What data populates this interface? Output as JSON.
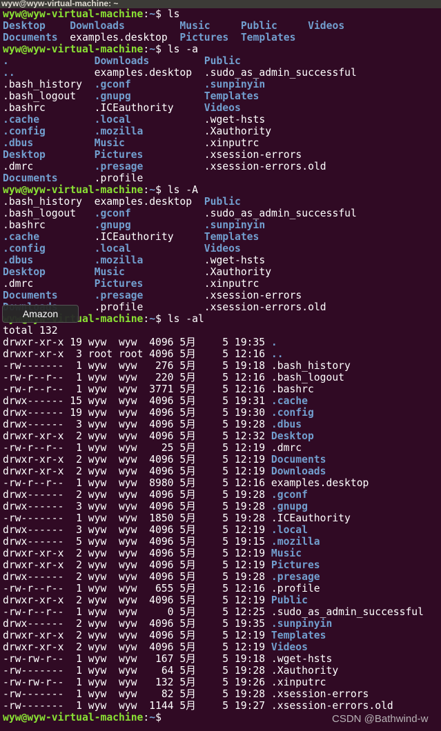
{
  "window": {
    "title": "wyw@wyw-virtual-machine: ~"
  },
  "prompt": {
    "user_host": "wyw@wyw-virtual-machine",
    "sep": ":",
    "path": "~",
    "symbol": "$ "
  },
  "colors": {
    "background": "#300a24",
    "prompt": "#8ae234",
    "directory": "#729fcf",
    "text": "#ffffff"
  },
  "listings": [
    {
      "command": "ls",
      "columns": [
        [
          {
            "name": "Desktop",
            "dir": true
          },
          {
            "name": "Documents",
            "dir": true
          }
        ],
        [
          {
            "name": "Downloads",
            "dir": true
          },
          {
            "name": "examples.desktop",
            "dir": false
          }
        ],
        [
          {
            "name": "Music",
            "dir": true
          },
          {
            "name": "Pictures",
            "dir": true
          }
        ],
        [
          {
            "name": "Public",
            "dir": true
          },
          {
            "name": "Templates",
            "dir": true
          }
        ],
        [
          {
            "name": "Videos",
            "dir": true
          }
        ]
      ]
    },
    {
      "command": "ls -a",
      "columns": [
        [
          {
            "name": ".",
            "dir": true
          },
          {
            "name": "..",
            "dir": true
          },
          {
            "name": ".bash_history",
            "dir": false
          },
          {
            "name": ".bash_logout",
            "dir": false
          },
          {
            "name": ".bashrc",
            "dir": false
          },
          {
            "name": ".cache",
            "dir": true
          },
          {
            "name": ".config",
            "dir": true
          },
          {
            "name": ".dbus",
            "dir": true
          },
          {
            "name": "Desktop",
            "dir": true
          },
          {
            "name": ".dmrc",
            "dir": false
          },
          {
            "name": "Documents",
            "dir": true
          }
        ],
        [
          {
            "name": "Downloads",
            "dir": true
          },
          {
            "name": "examples.desktop",
            "dir": false
          },
          {
            "name": ".gconf",
            "dir": true
          },
          {
            "name": ".gnupg",
            "dir": true
          },
          {
            "name": ".ICEauthority",
            "dir": false
          },
          {
            "name": ".local",
            "dir": true
          },
          {
            "name": ".mozilla",
            "dir": true
          },
          {
            "name": "Music",
            "dir": true
          },
          {
            "name": "Pictures",
            "dir": true
          },
          {
            "name": ".presage",
            "dir": true
          },
          {
            "name": ".profile",
            "dir": false
          }
        ],
        [
          {
            "name": "Public",
            "dir": true
          },
          {
            "name": ".sudo_as_admin_successful",
            "dir": false
          },
          {
            "name": ".sunpinyin",
            "dir": true
          },
          {
            "name": "Templates",
            "dir": true
          },
          {
            "name": "Videos",
            "dir": true
          },
          {
            "name": ".wget-hsts",
            "dir": false
          },
          {
            "name": ".Xauthority",
            "dir": false
          },
          {
            "name": ".xinputrc",
            "dir": false
          },
          {
            "name": ".xsession-errors",
            "dir": false
          },
          {
            "name": ".xsession-errors.old",
            "dir": false
          }
        ]
      ]
    },
    {
      "command": "ls -A",
      "columns": [
        [
          {
            "name": ".bash_history",
            "dir": false
          },
          {
            "name": ".bash_logout",
            "dir": false
          },
          {
            "name": ".bashrc",
            "dir": false
          },
          {
            "name": ".cache",
            "dir": true
          },
          {
            "name": ".config",
            "dir": true
          },
          {
            "name": ".dbus",
            "dir": true
          },
          {
            "name": "Desktop",
            "dir": true
          },
          {
            "name": ".dmrc",
            "dir": false
          },
          {
            "name": "Documents",
            "dir": true
          },
          {
            "name": "Downloads",
            "dir": true
          }
        ],
        [
          {
            "name": "examples.desktop",
            "dir": false
          },
          {
            "name": ".gconf",
            "dir": true
          },
          {
            "name": ".gnupg",
            "dir": true
          },
          {
            "name": ".ICEauthority",
            "dir": false
          },
          {
            "name": ".local",
            "dir": true
          },
          {
            "name": ".mozilla",
            "dir": true
          },
          {
            "name": "Music",
            "dir": true
          },
          {
            "name": "Pictures",
            "dir": true
          },
          {
            "name": ".presage",
            "dir": true
          },
          {
            "name": ".profile",
            "dir": false
          }
        ],
        [
          {
            "name": "Public",
            "dir": true
          },
          {
            "name": ".sudo_as_admin_successful",
            "dir": false
          },
          {
            "name": ".sunpinyin",
            "dir": true
          },
          {
            "name": "Templates",
            "dir": true
          },
          {
            "name": "Videos",
            "dir": true
          },
          {
            "name": ".wget-hsts",
            "dir": false
          },
          {
            "name": ".Xauthority",
            "dir": false
          },
          {
            "name": ".xinputrc",
            "dir": false
          },
          {
            "name": ".xsession-errors",
            "dir": false
          },
          {
            "name": ".xsession-errors.old",
            "dir": false
          }
        ]
      ]
    }
  ],
  "long_listing": {
    "command": "ls -al",
    "total": "total 132",
    "rows": [
      {
        "mode": "drwxr-xr-x",
        "links": "19",
        "owner": "wyw",
        "group": "wyw",
        "size": "4096",
        "month": "5月",
        "day": "5",
        "time": "19:35",
        "name": ".",
        "dir": true
      },
      {
        "mode": "drwxr-xr-x",
        "links": "3",
        "owner": "root",
        "group": "root",
        "size": "4096",
        "month": "5月",
        "day": "5",
        "time": "12:16",
        "name": "..",
        "dir": true
      },
      {
        "mode": "-rw-------",
        "links": "1",
        "owner": "wyw",
        "group": "wyw",
        "size": "276",
        "month": "5月",
        "day": "5",
        "time": "19:18",
        "name": ".bash_history",
        "dir": false
      },
      {
        "mode": "-rw-r--r--",
        "links": "1",
        "owner": "wyw",
        "group": "wyw",
        "size": "220",
        "month": "5月",
        "day": "5",
        "time": "12:16",
        "name": ".bash_logout",
        "dir": false
      },
      {
        "mode": "-rw-r--r--",
        "links": "1",
        "owner": "wyw",
        "group": "wyw",
        "size": "3771",
        "month": "5月",
        "day": "5",
        "time": "12:16",
        "name": ".bashrc",
        "dir": false
      },
      {
        "mode": "drwx------",
        "links": "15",
        "owner": "wyw",
        "group": "wyw",
        "size": "4096",
        "month": "5月",
        "day": "5",
        "time": "19:31",
        "name": ".cache",
        "dir": true
      },
      {
        "mode": "drwx------",
        "links": "19",
        "owner": "wyw",
        "group": "wyw",
        "size": "4096",
        "month": "5月",
        "day": "5",
        "time": "19:30",
        "name": ".config",
        "dir": true
      },
      {
        "mode": "drwx------",
        "links": "3",
        "owner": "wyw",
        "group": "wyw",
        "size": "4096",
        "month": "5月",
        "day": "5",
        "time": "19:28",
        "name": ".dbus",
        "dir": true
      },
      {
        "mode": "drwxr-xr-x",
        "links": "2",
        "owner": "wyw",
        "group": "wyw",
        "size": "4096",
        "month": "5月",
        "day": "5",
        "time": "12:32",
        "name": "Desktop",
        "dir": true
      },
      {
        "mode": "-rw-r--r--",
        "links": "1",
        "owner": "wyw",
        "group": "wyw",
        "size": "25",
        "month": "5月",
        "day": "5",
        "time": "12:19",
        "name": ".dmrc",
        "dir": false
      },
      {
        "mode": "drwxr-xr-x",
        "links": "2",
        "owner": "wyw",
        "group": "wyw",
        "size": "4096",
        "month": "5月",
        "day": "5",
        "time": "12:19",
        "name": "Documents",
        "dir": true
      },
      {
        "mode": "drwxr-xr-x",
        "links": "2",
        "owner": "wyw",
        "group": "wyw",
        "size": "4096",
        "month": "5月",
        "day": "5",
        "time": "12:19",
        "name": "Downloads",
        "dir": true
      },
      {
        "mode": "-rw-r--r--",
        "links": "1",
        "owner": "wyw",
        "group": "wyw",
        "size": "8980",
        "month": "5月",
        "day": "5",
        "time": "12:16",
        "name": "examples.desktop",
        "dir": false
      },
      {
        "mode": "drwx------",
        "links": "2",
        "owner": "wyw",
        "group": "wyw",
        "size": "4096",
        "month": "5月",
        "day": "5",
        "time": "19:28",
        "name": ".gconf",
        "dir": true
      },
      {
        "mode": "drwx------",
        "links": "3",
        "owner": "wyw",
        "group": "wyw",
        "size": "4096",
        "month": "5月",
        "day": "5",
        "time": "19:28",
        "name": ".gnupg",
        "dir": true
      },
      {
        "mode": "-rw-------",
        "links": "1",
        "owner": "wyw",
        "group": "wyw",
        "size": "1850",
        "month": "5月",
        "day": "5",
        "time": "19:28",
        "name": ".ICEauthority",
        "dir": false
      },
      {
        "mode": "drwx------",
        "links": "3",
        "owner": "wyw",
        "group": "wyw",
        "size": "4096",
        "month": "5月",
        "day": "5",
        "time": "12:19",
        "name": ".local",
        "dir": true
      },
      {
        "mode": "drwx------",
        "links": "5",
        "owner": "wyw",
        "group": "wyw",
        "size": "4096",
        "month": "5月",
        "day": "5",
        "time": "19:15",
        "name": ".mozilla",
        "dir": true
      },
      {
        "mode": "drwxr-xr-x",
        "links": "2",
        "owner": "wyw",
        "group": "wyw",
        "size": "4096",
        "month": "5月",
        "day": "5",
        "time": "12:19",
        "name": "Music",
        "dir": true
      },
      {
        "mode": "drwxr-xr-x",
        "links": "2",
        "owner": "wyw",
        "group": "wyw",
        "size": "4096",
        "month": "5月",
        "day": "5",
        "time": "12:19",
        "name": "Pictures",
        "dir": true
      },
      {
        "mode": "drwx------",
        "links": "2",
        "owner": "wyw",
        "group": "wyw",
        "size": "4096",
        "month": "5月",
        "day": "5",
        "time": "19:28",
        "name": ".presage",
        "dir": true
      },
      {
        "mode": "-rw-r--r--",
        "links": "1",
        "owner": "wyw",
        "group": "wyw",
        "size": "655",
        "month": "5月",
        "day": "5",
        "time": "12:16",
        "name": ".profile",
        "dir": false
      },
      {
        "mode": "drwxr-xr-x",
        "links": "2",
        "owner": "wyw",
        "group": "wyw",
        "size": "4096",
        "month": "5月",
        "day": "5",
        "time": "12:19",
        "name": "Public",
        "dir": true
      },
      {
        "mode": "-rw-r--r--",
        "links": "1",
        "owner": "wyw",
        "group": "wyw",
        "size": "0",
        "month": "5月",
        "day": "5",
        "time": "12:25",
        "name": ".sudo_as_admin_successful",
        "dir": false
      },
      {
        "mode": "drwx------",
        "links": "2",
        "owner": "wyw",
        "group": "wyw",
        "size": "4096",
        "month": "5月",
        "day": "5",
        "time": "19:35",
        "name": ".sunpinyin",
        "dir": true
      },
      {
        "mode": "drwxr-xr-x",
        "links": "2",
        "owner": "wyw",
        "group": "wyw",
        "size": "4096",
        "month": "5月",
        "day": "5",
        "time": "12:19",
        "name": "Templates",
        "dir": true
      },
      {
        "mode": "drwxr-xr-x",
        "links": "2",
        "owner": "wyw",
        "group": "wyw",
        "size": "4096",
        "month": "5月",
        "day": "5",
        "time": "12:19",
        "name": "Videos",
        "dir": true
      },
      {
        "mode": "-rw-rw-r--",
        "links": "1",
        "owner": "wyw",
        "group": "wyw",
        "size": "167",
        "month": "5月",
        "day": "5",
        "time": "19:18",
        "name": ".wget-hsts",
        "dir": false
      },
      {
        "mode": "-rw-------",
        "links": "1",
        "owner": "wyw",
        "group": "wyw",
        "size": "64",
        "month": "5月",
        "day": "5",
        "time": "19:28",
        "name": ".Xauthority",
        "dir": false
      },
      {
        "mode": "-rw-rw-r--",
        "links": "1",
        "owner": "wyw",
        "group": "wyw",
        "size": "132",
        "month": "5月",
        "day": "5",
        "time": "19:26",
        "name": ".xinputrc",
        "dir": false
      },
      {
        "mode": "-rw-------",
        "links": "1",
        "owner": "wyw",
        "group": "wyw",
        "size": "82",
        "month": "5月",
        "day": "5",
        "time": "19:28",
        "name": ".xsession-errors",
        "dir": false
      },
      {
        "mode": "-rw-------",
        "links": "1",
        "owner": "wyw",
        "group": "wyw",
        "size": "1144",
        "month": "5月",
        "day": "5",
        "time": "19:27",
        "name": ".xsession-errors.old",
        "dir": false
      }
    ]
  },
  "tooltip": {
    "label": "Amazon"
  },
  "watermark": "CSDN @Bathwind-w"
}
